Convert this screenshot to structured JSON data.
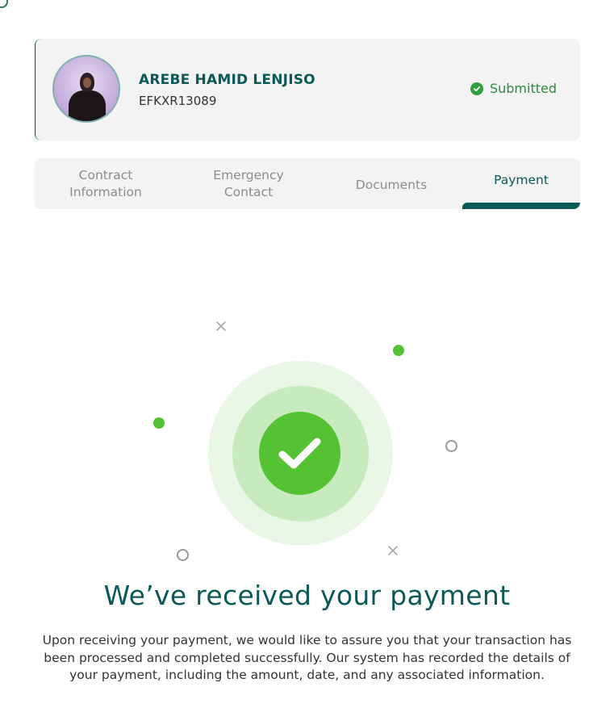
{
  "profile": {
    "name": "AREBE HAMID LENJISO",
    "id": "EFKXR13089",
    "status": "Submitted",
    "status_icon": "check-circle-icon"
  },
  "tabs": [
    {
      "label": "Contract Information",
      "line1": "Contract",
      "line2": "Information",
      "active": false
    },
    {
      "label": "Emergency Contact",
      "line1": "Emergency",
      "line2": "Contact",
      "active": false
    },
    {
      "label": "Documents",
      "active": false
    },
    {
      "label": "Payment",
      "active": true
    }
  ],
  "payment": {
    "headline": "We’ve received your payment",
    "description": "Upon receiving your payment, we would like to assure you that your transaction has been processed and completed successfully. Our system has recorded the details of your payment, including the amount, date, and any associated information.",
    "icon": "check-icon"
  },
  "colors": {
    "brand": "#0b5a57",
    "success": "#55c234",
    "status": "#2e8a3c",
    "card_bg": "#f3f3f3"
  }
}
